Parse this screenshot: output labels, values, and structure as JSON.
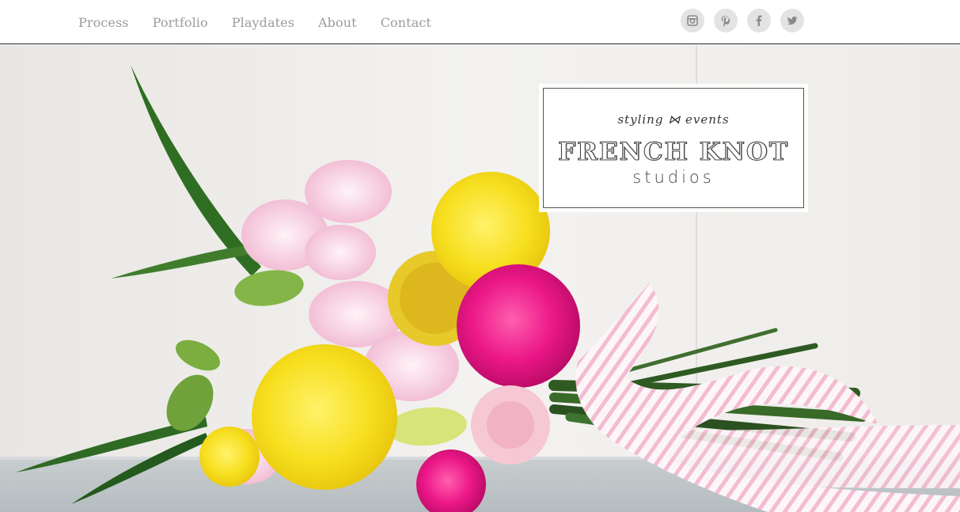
{
  "nav": {
    "items": [
      {
        "label": "Process"
      },
      {
        "label": "Portfolio"
      },
      {
        "label": "Playdates"
      },
      {
        "label": "About"
      },
      {
        "label": "Contact"
      }
    ]
  },
  "social": {
    "icons": [
      "instagram-icon",
      "pinterest-icon",
      "facebook-icon",
      "twitter-icon"
    ]
  },
  "logo": {
    "tagline": "styling ⋈ events",
    "brand": "FRENCH KNOT",
    "sub": "studios"
  },
  "colors": {
    "nav_text": "#9b9b9b",
    "social_bg": "#e3e3e3",
    "social_icon": "#8a8a8a",
    "pink_flower": "#e8137f",
    "yellow_flower": "#f7e22a",
    "ribbon_stripe": "#f3b9cf"
  }
}
